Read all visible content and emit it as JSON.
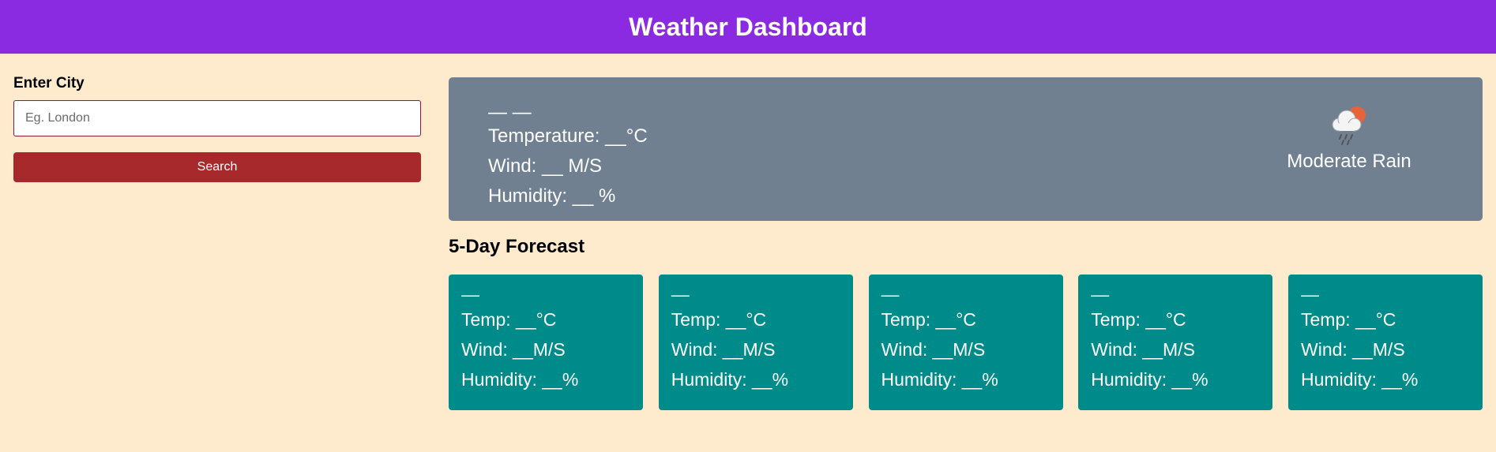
{
  "header": {
    "title": "Weather Dashboard"
  },
  "search": {
    "label": "Enter City",
    "placeholder": "Eg. London",
    "value": "",
    "button_label": "Search"
  },
  "current": {
    "date": "— —",
    "temperature": "Temperature: __°C",
    "wind": "Wind: __ M/S",
    "humidity": "Humidity: __ %",
    "condition_icon": "cloud-sun-rain-icon",
    "condition": "Moderate Rain"
  },
  "forecast": {
    "title": "5-Day Forecast",
    "days": [
      {
        "date": "—",
        "temp": "Temp: __°C",
        "wind": "Wind: __M/S",
        "humidity": "Humidity: __%"
      },
      {
        "date": "—",
        "temp": "Temp: __°C",
        "wind": "Wind: __M/S",
        "humidity": "Humidity: __%"
      },
      {
        "date": "—",
        "temp": "Temp: __°C",
        "wind": "Wind: __M/S",
        "humidity": "Humidity: __%"
      },
      {
        "date": "—",
        "temp": "Temp: __°C",
        "wind": "Wind: __M/S",
        "humidity": "Humidity: __%"
      },
      {
        "date": "—",
        "temp": "Temp: __°C",
        "wind": "Wind: __M/S",
        "humidity": "Humidity: __%"
      }
    ]
  },
  "colors": {
    "header_bg": "#8a2be2",
    "page_bg": "#feebcd",
    "current_bg": "#708090",
    "card_bg": "#008b8b",
    "button_bg": "#a8292b"
  }
}
